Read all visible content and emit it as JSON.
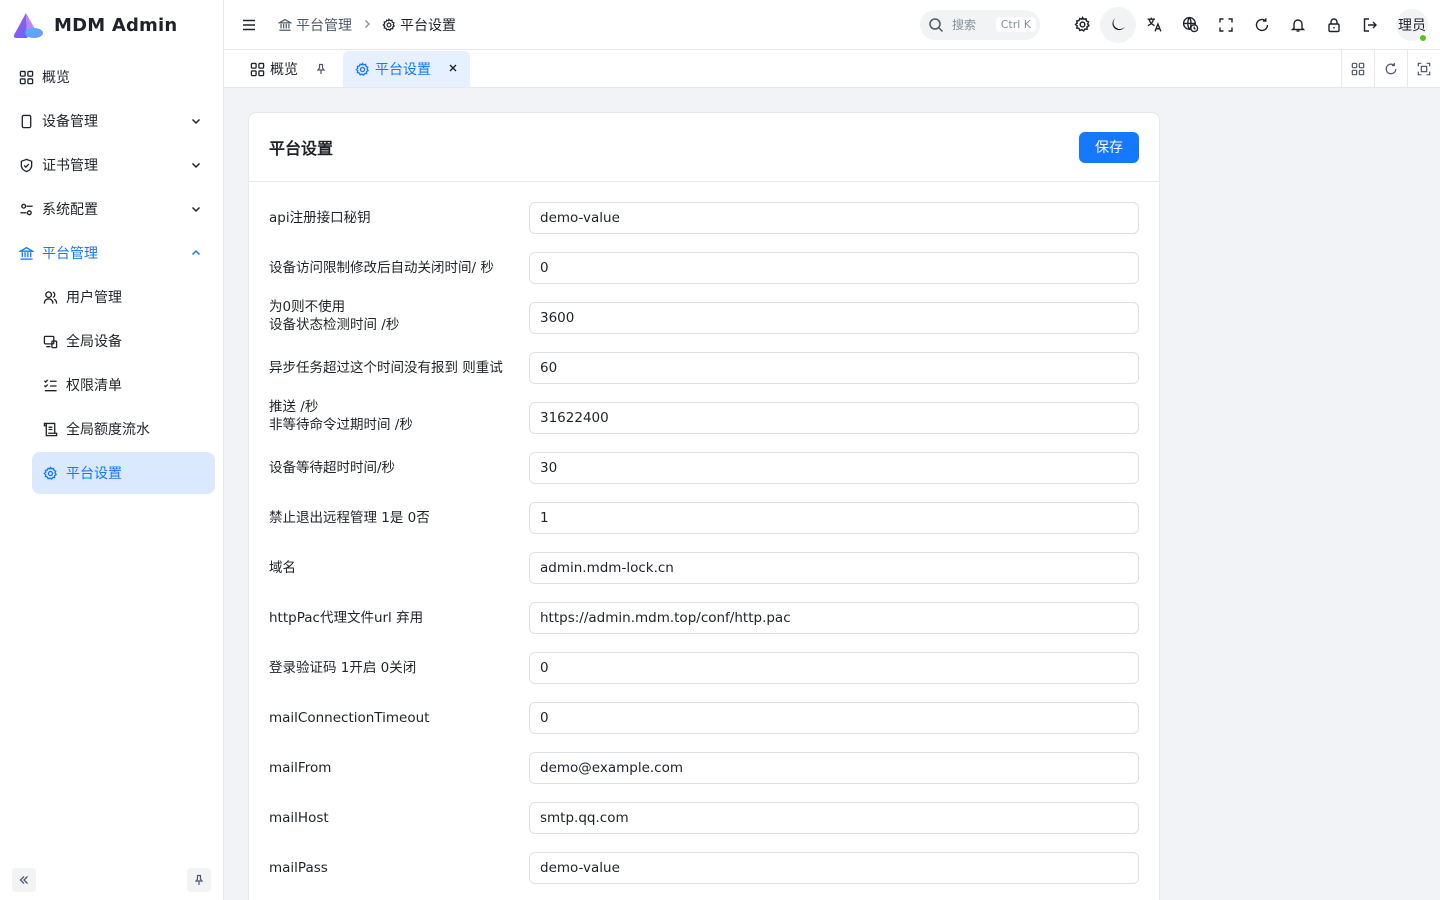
{
  "app": {
    "title": "MDM Admin"
  },
  "sidebar": {
    "items": [
      {
        "label": "概览"
      },
      {
        "label": "设备管理"
      },
      {
        "label": "证书管理"
      },
      {
        "label": "系统配置"
      },
      {
        "label": "平台管理"
      },
      {
        "label": "用户管理"
      },
      {
        "label": "全局设备"
      },
      {
        "label": "权限清单"
      },
      {
        "label": "全局额度流水"
      },
      {
        "label": "平台设置"
      }
    ]
  },
  "header": {
    "breadcrumb": [
      "平台管理",
      "平台设置"
    ],
    "search_label": "搜索",
    "search_shortcut": "Ctrl K",
    "avatar_text": "理员"
  },
  "tabs": [
    {
      "label": "概览"
    },
    {
      "label": "平台设置"
    }
  ],
  "card": {
    "title": "平台设置",
    "save_label": "保存"
  },
  "form": {
    "fields": [
      {
        "label": "api注册接口秘钥",
        "value": "demo-value"
      },
      {
        "label": "设备访问限制修改后自动关闭时间/ 秒",
        "value": "0"
      },
      {
        "label": "为0则不使用\n设备状态检测时间 /秒",
        "value": "3600"
      },
      {
        "label": "异步任务超过这个时间没有报到 则重试",
        "value": "60"
      },
      {
        "label": "推送 /秒\n非等待命令过期时间 /秒",
        "value": "31622400"
      },
      {
        "label": "设备等待超时时间/秒",
        "value": "30"
      },
      {
        "label": "禁止退出远程管理 1是 0否",
        "value": "1"
      },
      {
        "label": "域名",
        "value": "admin.mdm-lock.cn"
      },
      {
        "label": "httpPac代理文件url 弃用",
        "value": "https://admin.mdm.top/conf/http.pac"
      },
      {
        "label": "登录验证码 1开启 0关闭",
        "value": "0"
      },
      {
        "label": "mailConnectionTimeout",
        "value": "0"
      },
      {
        "label": "mailFrom",
        "value": "demo@example.com"
      },
      {
        "label": "mailHost",
        "value": "smtp.qq.com"
      },
      {
        "label": "mailPass",
        "value": "demo-value"
      }
    ]
  },
  "colors": {
    "accent": "#1677ff",
    "active_bg": "#dbe9ff",
    "online": "#52c41a"
  }
}
